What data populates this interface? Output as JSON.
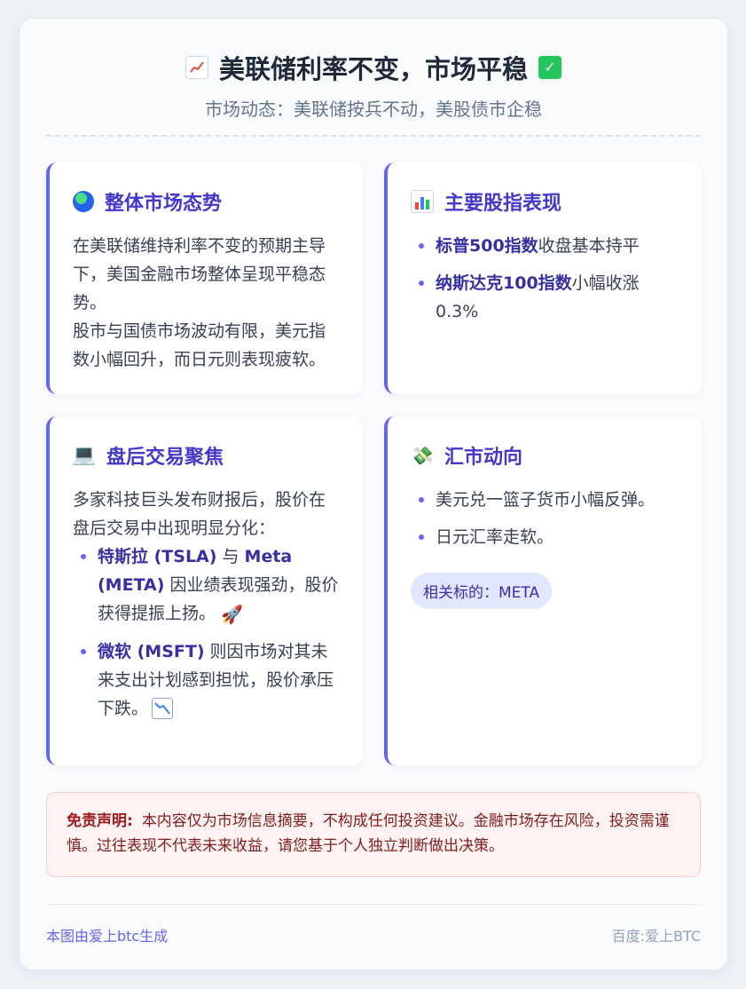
{
  "header": {
    "title": "美联储利率不变，市场平稳",
    "title_icon_left": "chart-increasing-icon",
    "title_icon_right": "check-mark-icon",
    "subtitle": "市场动态：美联储按兵不动，美股债市企稳"
  },
  "panels": {
    "overall": {
      "icon": "globe-icon",
      "title": "整体市场态势",
      "para1": "在美联储维持利率不变的预期主导下，美国金融市场整体呈现平稳态势。",
      "para2": "股市与国债市场波动有限，美元指数小幅回升，而日元则表现疲软。"
    },
    "indices": {
      "icon": "bar-chart-icon",
      "title": "主要股指表现",
      "items": [
        {
          "highlight": "标普500指数",
          "text": "收盘基本持平"
        },
        {
          "highlight": "纳斯达克100指数",
          "text": "小幅收涨0.3%"
        }
      ]
    },
    "afterhours": {
      "icon": "laptop-icon",
      "title": "盘后交易聚焦",
      "intro": "多家科技巨头发布财报后，股价在盘后交易中出现明显分化：",
      "item1_hl_a": "特斯拉 (TSLA)",
      "item1_and": " 与 ",
      "item1_hl_b": "Meta (META)",
      "item1_text": " 因业绩表现强劲，股价获得提振上扬。",
      "item1_emoji": "🚀",
      "item2_hl": "微软 (MSFT)",
      "item2_text": " 则因市场对其未来支出计划感到担忧，股价承压下跌。"
    },
    "fx": {
      "icon": "money-wings-icon",
      "title": "汇市动向",
      "items": [
        "美元兑一篮子货币小幅反弹。",
        "日元汇率走软。"
      ],
      "tag": "相关标的：META"
    }
  },
  "disclaimer": {
    "label": "免责声明:",
    "text": "本内容仅为市场信息摘要，不构成任何投资建议。金融市场存在风险，投资需谨慎。过往表现不代表未来收益，请您基于个人独立判断做出决策。"
  },
  "footer": {
    "left": "本图由爱上btc生成",
    "right": "百度:爱上BTC"
  },
  "colors": {
    "accent": "#6366f1",
    "heading": "#4338ca",
    "disclaimer_bg": "#fef2f2"
  }
}
